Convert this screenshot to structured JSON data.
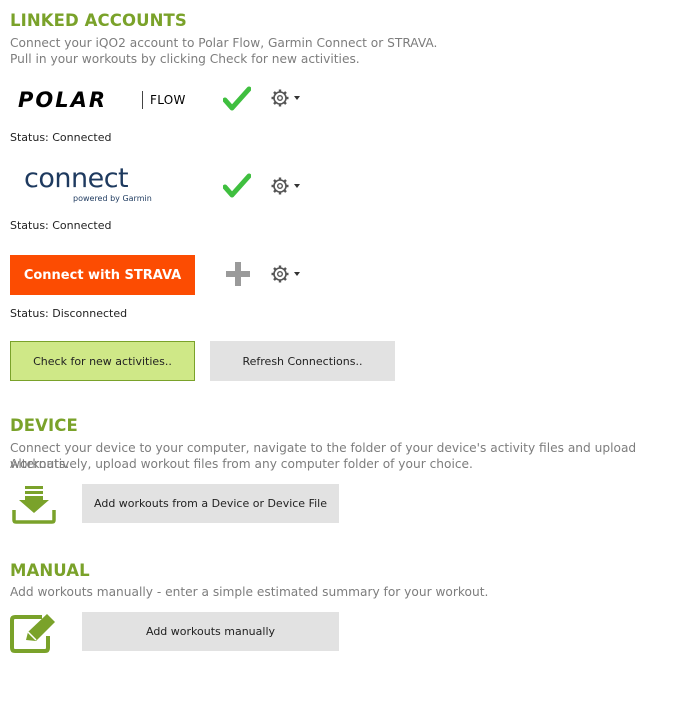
{
  "linked": {
    "title": "LINKED ACCOUNTS",
    "desc1": "Connect your iQO2 account to Polar Flow, Garmin Connect or STRAVA.",
    "desc2": "Pull in your workouts by clicking Check for new activities.",
    "accounts": [
      {
        "name": "Polar Flow",
        "logo_text": "POLAR",
        "logo_suffix": "FLOW",
        "status": "Status: Connected",
        "state_icon": "checkmark-icon"
      },
      {
        "name": "Garmin Connect",
        "logo_text": "connect",
        "logo_sub": "powered by Garmin",
        "status": "Status: Connected",
        "state_icon": "checkmark-icon"
      },
      {
        "name": "STRAVA",
        "logo_text": "Connect with STRAVA",
        "status": "Status: Disconnected",
        "state_icon": "plus-icon"
      }
    ],
    "check_btn": "Check for new activities..",
    "refresh_btn": "Refresh Connections.."
  },
  "device": {
    "title": "DEVICE",
    "desc1": "Connect your device to your computer, navigate to the folder of your device's activity files and upload workouts.",
    "desc2": "Alternatively, upload workout files from any computer folder of your choice.",
    "button": "Add workouts from a Device or Device File",
    "icon": "download-tray-icon"
  },
  "manual": {
    "title": "MANUAL",
    "desc": "Add workouts manually - enter a simple estimated summary for your workout.",
    "button": "Add workouts manually",
    "icon": "edit-pencil-icon"
  },
  "colors": {
    "accent": "#7aa22a",
    "check": "#3fbf3f",
    "strava": "#fc4c02",
    "polar": "#d10027",
    "garmin": "#1e3a5f",
    "button_bg": "#e2e2e2",
    "button_green": "#cfe887"
  }
}
